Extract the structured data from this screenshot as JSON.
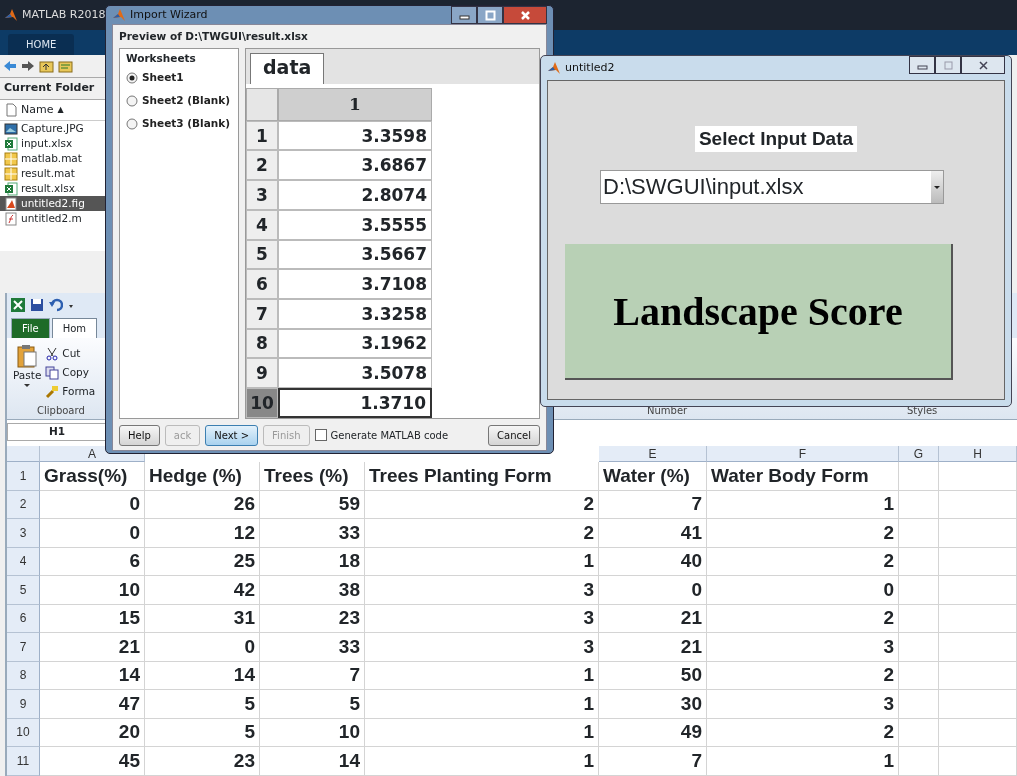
{
  "matlab": {
    "title": "MATLAB R2018",
    "tabs": [
      {
        "label": "HOME",
        "selected": true
      }
    ],
    "current_folder": {
      "title": "Current Folder",
      "column": "Name",
      "sort_indicator": "▲",
      "files": [
        {
          "name": "Capture.JPG",
          "kind": "image",
          "selected": false
        },
        {
          "name": "input.xlsx",
          "kind": "excel",
          "selected": false
        },
        {
          "name": "matlab.mat",
          "kind": "mat",
          "selected": false
        },
        {
          "name": "result.mat",
          "kind": "mat",
          "selected": false
        },
        {
          "name": "result.xlsx",
          "kind": "excel",
          "selected": false
        },
        {
          "name": "untitled2.fig",
          "kind": "fig",
          "selected": true
        },
        {
          "name": "untitled2.m",
          "kind": "script",
          "selected": false
        }
      ]
    }
  },
  "excel": {
    "tabs": [
      {
        "label": "File",
        "selected": false
      },
      {
        "label": "Hom",
        "selected": true
      }
    ],
    "clipboard": {
      "paste": "Paste",
      "cut": "Cut",
      "copy": "Copy",
      "format": "Forma",
      "group": "Clipboard"
    },
    "ribbon_groups": [
      "Number",
      "Styles"
    ],
    "name_box": "H1",
    "columns": [
      {
        "label": "A"
      },
      {},
      {},
      {},
      {
        "label": "E"
      },
      {
        "label": "F"
      },
      {
        "label": "G"
      },
      {
        "label": "H"
      }
    ],
    "rows": [
      {
        "number": "1",
        "kind": "header",
        "cells": [
          "Grass(%)",
          "Hedge (%)",
          "Trees (%)",
          "Trees Planting Form",
          "Water (%)",
          "Water Body Form"
        ]
      },
      {
        "number": "2",
        "kind": "data",
        "cells": [
          "0",
          "26",
          "59",
          "2",
          "7",
          "1"
        ]
      },
      {
        "number": "3",
        "kind": "data",
        "cells": [
          "0",
          "12",
          "33",
          "2",
          "41",
          "2"
        ]
      },
      {
        "number": "4",
        "kind": "data",
        "cells": [
          "6",
          "25",
          "18",
          "1",
          "40",
          "2"
        ]
      },
      {
        "number": "5",
        "kind": "data",
        "cells": [
          "10",
          "42",
          "38",
          "3",
          "0",
          "0"
        ]
      },
      {
        "number": "6",
        "kind": "data",
        "cells": [
          "15",
          "31",
          "23",
          "3",
          "21",
          "2"
        ]
      },
      {
        "number": "7",
        "kind": "data",
        "cells": [
          "21",
          "0",
          "33",
          "3",
          "21",
          "3"
        ]
      },
      {
        "number": "8",
        "kind": "data",
        "cells": [
          "14",
          "14",
          "7",
          "1",
          "50",
          "2"
        ]
      },
      {
        "number": "9",
        "kind": "data",
        "cells": [
          "47",
          "5",
          "5",
          "1",
          "30",
          "3"
        ]
      },
      {
        "number": "10",
        "kind": "data",
        "cells": [
          "20",
          "5",
          "10",
          "1",
          "49",
          "2"
        ]
      },
      {
        "number": "11",
        "kind": "data",
        "cells": [
          "45",
          "23",
          "14",
          "1",
          "7",
          "1"
        ]
      }
    ]
  },
  "import_wizard": {
    "title": "Import Wizard",
    "preview": "Preview of D:\\TWGUI\\result.xlsx",
    "worksheets_title": "Worksheets",
    "sheets": [
      {
        "label": "Sheet1",
        "selected": true
      },
      {
        "label": "Sheet2 (Blank)",
        "selected": false
      },
      {
        "label": "Sheet3 (Blank)",
        "selected": false
      }
    ],
    "tab": "data",
    "column": "1",
    "rows": [
      {
        "number": "1",
        "value": "3.3598",
        "selected": false
      },
      {
        "number": "2",
        "value": "3.6867",
        "selected": false
      },
      {
        "number": "3",
        "value": "2.8074",
        "selected": false
      },
      {
        "number": "4",
        "value": "3.5555",
        "selected": false
      },
      {
        "number": "5",
        "value": "3.5667",
        "selected": false
      },
      {
        "number": "6",
        "value": "3.7108",
        "selected": false
      },
      {
        "number": "7",
        "value": "3.3258",
        "selected": false
      },
      {
        "number": "8",
        "value": "3.1962",
        "selected": false
      },
      {
        "number": "9",
        "value": "3.5078",
        "selected": false
      },
      {
        "number": "10",
        "value": "1.3710",
        "selected": true
      }
    ],
    "buttons": [
      {
        "label": "Help",
        "disabled": false,
        "default": false
      },
      {
        "label": "ack",
        "disabled": true,
        "default": false
      },
      {
        "label": "Next >",
        "disabled": false,
        "default": true
      },
      {
        "label": "Finish",
        "disabled": true,
        "default": false
      }
    ],
    "generate_code": {
      "label": "Generate MATLAB code",
      "checked": false
    },
    "cancel": "Cancel"
  },
  "gui_window": {
    "title": "untitled2",
    "label": "Select Input Data",
    "popup_value": "D:\\SWGUI\\input.xlsx",
    "button": "Landscape Score"
  }
}
